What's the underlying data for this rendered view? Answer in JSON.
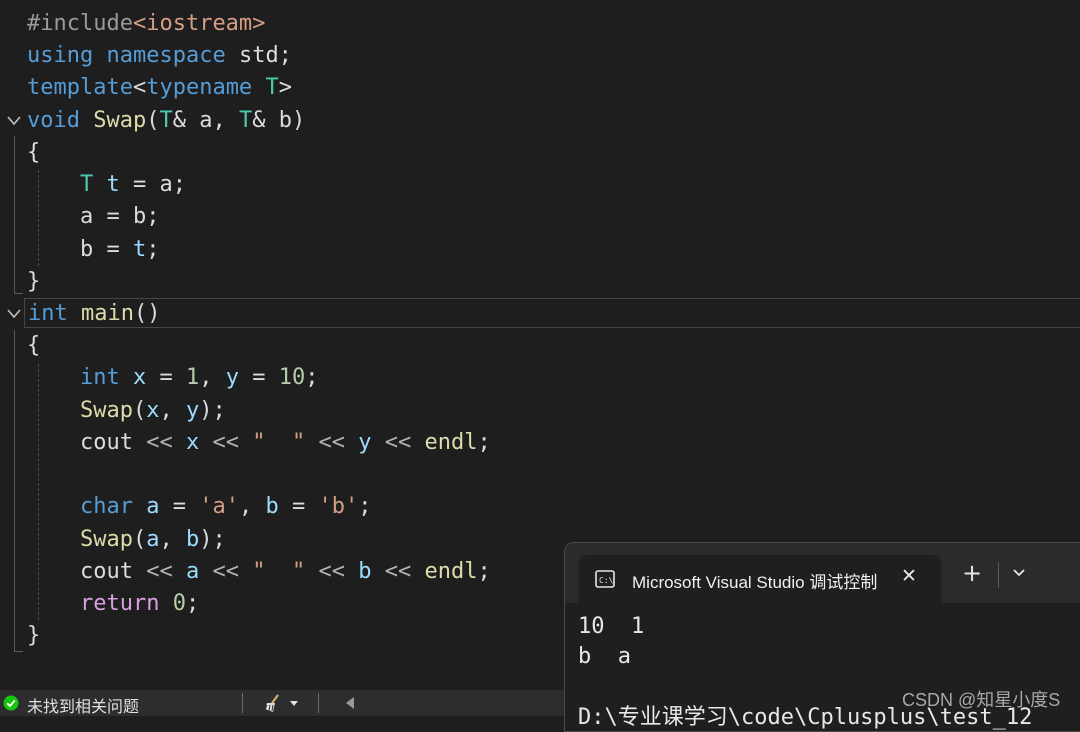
{
  "editor": {
    "lines": [
      {
        "tokens": [
          {
            "c": "pr",
            "t": "#include"
          },
          {
            "c": "st",
            "t": "<iostream>"
          }
        ]
      },
      {
        "tokens": [
          {
            "c": "kw",
            "t": "using"
          },
          {
            "c": "df",
            "t": " "
          },
          {
            "c": "kw",
            "t": "namespace"
          },
          {
            "c": "df",
            "t": " std;"
          }
        ]
      },
      {
        "tokens": [
          {
            "c": "kw",
            "t": "template"
          },
          {
            "c": "df",
            "t": "<"
          },
          {
            "c": "kw",
            "t": "typename"
          },
          {
            "c": "df",
            "t": " "
          },
          {
            "c": "ty",
            "t": "T"
          },
          {
            "c": "df",
            "t": ">"
          }
        ]
      },
      {
        "tokens": [
          {
            "c": "kw",
            "t": "void"
          },
          {
            "c": "df",
            "t": " "
          },
          {
            "c": "fn",
            "t": "Swap"
          },
          {
            "c": "df",
            "t": "("
          },
          {
            "c": "ty",
            "t": "T"
          },
          {
            "c": "df",
            "t": "& a, "
          },
          {
            "c": "ty",
            "t": "T"
          },
          {
            "c": "df",
            "t": "& b)"
          }
        ]
      },
      {
        "tokens": [
          {
            "c": "df",
            "t": "{"
          }
        ]
      },
      {
        "tokens": [
          {
            "c": "ty",
            "t": "T"
          },
          {
            "c": "df",
            "t": " "
          },
          {
            "c": "vr",
            "t": "t"
          },
          {
            "c": "df",
            "t": " = a;"
          }
        ]
      },
      {
        "tokens": [
          {
            "c": "df",
            "t": "a = b;"
          }
        ]
      },
      {
        "tokens": [
          {
            "c": "df",
            "t": "b = "
          },
          {
            "c": "vr",
            "t": "t"
          },
          {
            "c": "df",
            "t": ";"
          }
        ]
      },
      {
        "tokens": [
          {
            "c": "df",
            "t": "}"
          }
        ]
      },
      {
        "tokens": [
          {
            "c": "kw",
            "t": "int"
          },
          {
            "c": "df",
            "t": " "
          },
          {
            "c": "fn",
            "t": "main"
          },
          {
            "c": "df",
            "t": "()"
          }
        ]
      },
      {
        "tokens": [
          {
            "c": "df",
            "t": "{"
          }
        ]
      },
      {
        "tokens": [
          {
            "c": "kw",
            "t": "int"
          },
          {
            "c": "df",
            "t": " "
          },
          {
            "c": "vr",
            "t": "x"
          },
          {
            "c": "df",
            "t": " = "
          },
          {
            "c": "nm",
            "t": "1"
          },
          {
            "c": "df",
            "t": ", "
          },
          {
            "c": "vr",
            "t": "y"
          },
          {
            "c": "df",
            "t": " = "
          },
          {
            "c": "nm",
            "t": "10"
          },
          {
            "c": "df",
            "t": ";"
          }
        ]
      },
      {
        "tokens": [
          {
            "c": "fn",
            "t": "Swap"
          },
          {
            "c": "df",
            "t": "("
          },
          {
            "c": "vr",
            "t": "x"
          },
          {
            "c": "df",
            "t": ", "
          },
          {
            "c": "vr",
            "t": "y"
          },
          {
            "c": "df",
            "t": ");"
          }
        ]
      },
      {
        "tokens": [
          {
            "c": "df",
            "t": "cout "
          },
          {
            "c": "op",
            "t": "<<"
          },
          {
            "c": "df",
            "t": " "
          },
          {
            "c": "vr",
            "t": "x"
          },
          {
            "c": "df",
            "t": " "
          },
          {
            "c": "op",
            "t": "<<"
          },
          {
            "c": "df",
            "t": " "
          },
          {
            "c": "st",
            "t": "\"  \""
          },
          {
            "c": "df",
            "t": " "
          },
          {
            "c": "op",
            "t": "<<"
          },
          {
            "c": "df",
            "t": " "
          },
          {
            "c": "vr",
            "t": "y"
          },
          {
            "c": "df",
            "t": " "
          },
          {
            "c": "op",
            "t": "<<"
          },
          {
            "c": "df",
            "t": " "
          },
          {
            "c": "fn",
            "t": "endl"
          },
          {
            "c": "df",
            "t": ";"
          }
        ]
      },
      {
        "tokens": []
      },
      {
        "tokens": [
          {
            "c": "kw",
            "t": "char"
          },
          {
            "c": "df",
            "t": " "
          },
          {
            "c": "vr",
            "t": "a"
          },
          {
            "c": "df",
            "t": " = "
          },
          {
            "c": "st",
            "t": "'a'"
          },
          {
            "c": "df",
            "t": ", "
          },
          {
            "c": "vr",
            "t": "b"
          },
          {
            "c": "df",
            "t": " = "
          },
          {
            "c": "st",
            "t": "'b'"
          },
          {
            "c": "df",
            "t": ";"
          }
        ]
      },
      {
        "tokens": [
          {
            "c": "fn",
            "t": "Swap"
          },
          {
            "c": "df",
            "t": "("
          },
          {
            "c": "vr",
            "t": "a"
          },
          {
            "c": "df",
            "t": ", "
          },
          {
            "c": "vr",
            "t": "b"
          },
          {
            "c": "df",
            "t": ");"
          }
        ]
      },
      {
        "tokens": [
          {
            "c": "df",
            "t": "cout "
          },
          {
            "c": "op",
            "t": "<<"
          },
          {
            "c": "df",
            "t": " "
          },
          {
            "c": "vr",
            "t": "a"
          },
          {
            "c": "df",
            "t": " "
          },
          {
            "c": "op",
            "t": "<<"
          },
          {
            "c": "df",
            "t": " "
          },
          {
            "c": "st",
            "t": "\"  \""
          },
          {
            "c": "df",
            "t": " "
          },
          {
            "c": "op",
            "t": "<<"
          },
          {
            "c": "df",
            "t": " "
          },
          {
            "c": "vr",
            "t": "b"
          },
          {
            "c": "df",
            "t": " "
          },
          {
            "c": "op",
            "t": "<<"
          },
          {
            "c": "df",
            "t": " "
          },
          {
            "c": "fn",
            "t": "endl"
          },
          {
            "c": "df",
            "t": ";"
          }
        ]
      },
      {
        "tokens": [
          {
            "c": "cf",
            "t": "return"
          },
          {
            "c": "df",
            "t": " "
          },
          {
            "c": "nm",
            "t": "0"
          },
          {
            "c": "df",
            "t": ";"
          }
        ]
      },
      {
        "tokens": [
          {
            "c": "df",
            "t": "}"
          }
        ]
      }
    ]
  },
  "statusbar": {
    "issues_text": "未找到相关问题",
    "issues_icon": "check-circle-icon",
    "cleanup_icon": "broom-icon"
  },
  "console": {
    "tab_title": "Microsoft Visual Studio 调试控制台",
    "tab_icon": "console-icon",
    "close_glyph": "✕",
    "new_tab_glyph": "+",
    "dropdown_glyph": "⌄",
    "output": [
      "10  1",
      "b  a",
      "",
      "D:\\专业课学习\\code\\Cplusplus\\test_12"
    ]
  },
  "watermark": "CSDN @知星小度S",
  "colors": {
    "keyword": "#569cd6",
    "control_keyword": "#d8a0df",
    "type": "#4ec9b0",
    "function": "#dcdcaa",
    "variable": "#9cdcfe",
    "string": "#d69d85",
    "number": "#b5cea8",
    "status_ok": "#16c60c"
  }
}
